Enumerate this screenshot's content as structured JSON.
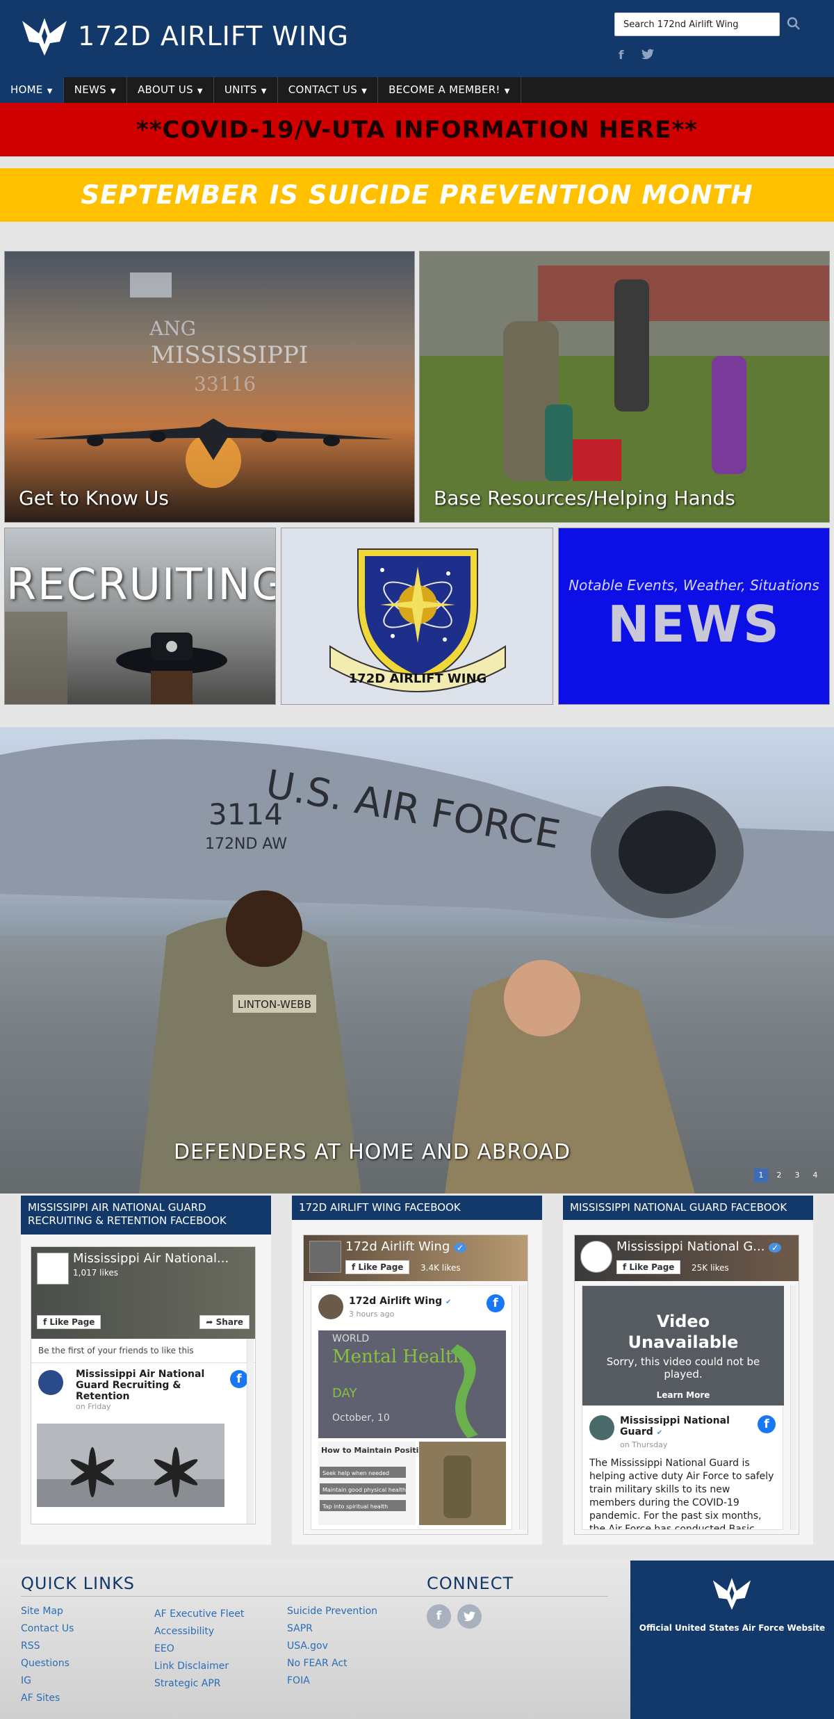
{
  "header": {
    "title": "172D AIRLIFT WING",
    "search_placeholder": "Search 172nd Airlift Wing",
    "social": [
      "f",
      "t"
    ]
  },
  "nav": {
    "items": [
      "HOME",
      "NEWS",
      "ABOUT US",
      "UNITS",
      "CONTACT US",
      "BECOME A MEMBER!"
    ]
  },
  "banners": {
    "covid": "**COVID-19/V-UTA INFORMATION HERE**",
    "suicide": "SEPTEMBER IS SUICIDE PREVENTION MONTH"
  },
  "tiles": {
    "know_us": "Get to Know Us",
    "base_resources": "Base Resources/Helping Hands",
    "recruiting": "RECRUITING",
    "shield_text": "172D AIRLIFT WING",
    "news_small": "Notable Events, Weather, Situations",
    "news_big": "NEWS",
    "plane_text": {
      "ang": "ANG",
      "state": "MISSISSIPPI",
      "tail": "33116"
    }
  },
  "hero": {
    "caption": "DEFENDERS AT HOME AND ABROAD",
    "plane_text": {
      "usaf": "U.S. AIR FORCE",
      "tail": "3114",
      "wing": "172ND AW"
    },
    "name_tag": "LINTON-WEBB",
    "dots": [
      "1",
      "2",
      "3",
      "4"
    ]
  },
  "facebook": {
    "col1": {
      "header": "MISSISSIPPI AIR NATIONAL GUARD RECRUITING & RETENTION FACEBOOK",
      "page_name": "Mississippi Air National...",
      "likes": "1,017 likes",
      "like_btn": "Like Page",
      "share_btn": "Share",
      "friends_text": "Be the first of your friends to like this",
      "post_title": "Mississippi Air National Guard Recruiting & Retention",
      "post_time": "on Friday"
    },
    "col2": {
      "header": "172D AIRLIFT WING FACEBOOK",
      "page_name": "172d Airlift Wing",
      "likes": "3.4K likes",
      "like_btn": "Like Page",
      "post_title": "172d Airlift Wing",
      "post_time": "3 hours ago",
      "img_world": "WORLD",
      "img_title": "Mental Health",
      "img_day": "DAY",
      "img_date": "October, 10",
      "tips_title": "How to Maintain Positive Mental Health",
      "tips": [
        "Seek help when needed",
        "Maintain good physical health",
        "Tap into spiritual health"
      ]
    },
    "col3": {
      "header": "MISSISSIPPI NATIONAL GUARD FACEBOOK",
      "page_name": "Mississippi National G...",
      "likes": "25K likes",
      "like_btn": "Like Page",
      "video_title": "Video Unavailable",
      "video_sub": "Sorry, this video could not be played.",
      "video_link": "Learn More",
      "post_title": "Mississippi National Guard",
      "post_time": "on Thursday",
      "post_body": "The Mississippi National Guard is helping active duty Air Force to safely train military skills to its new members during the COVID-19 pandemic. For the past six months, the Air Force has conducted Basic"
    }
  },
  "footer": {
    "quick_links_title": "QUICK LINKS",
    "col1": [
      "Site Map",
      "Contact Us",
      "RSS",
      "Questions",
      "IG",
      "AF Sites"
    ],
    "col2": [
      "AF Executive Fleet",
      "Accessibility",
      "EEO",
      "Link Disclaimer",
      "Strategic APR"
    ],
    "col3": [
      "Suicide Prevention",
      "SAPR",
      "USA.gov",
      "No FEAR Act",
      "FOIA"
    ],
    "connect_title": "CONNECT",
    "af_site": "Official United States Air Force Website"
  },
  "colors": {
    "navy": "#13386a",
    "red_banner": "#d10000",
    "yellow_banner": "#ffc000",
    "news_blue": "#0c10e6"
  }
}
